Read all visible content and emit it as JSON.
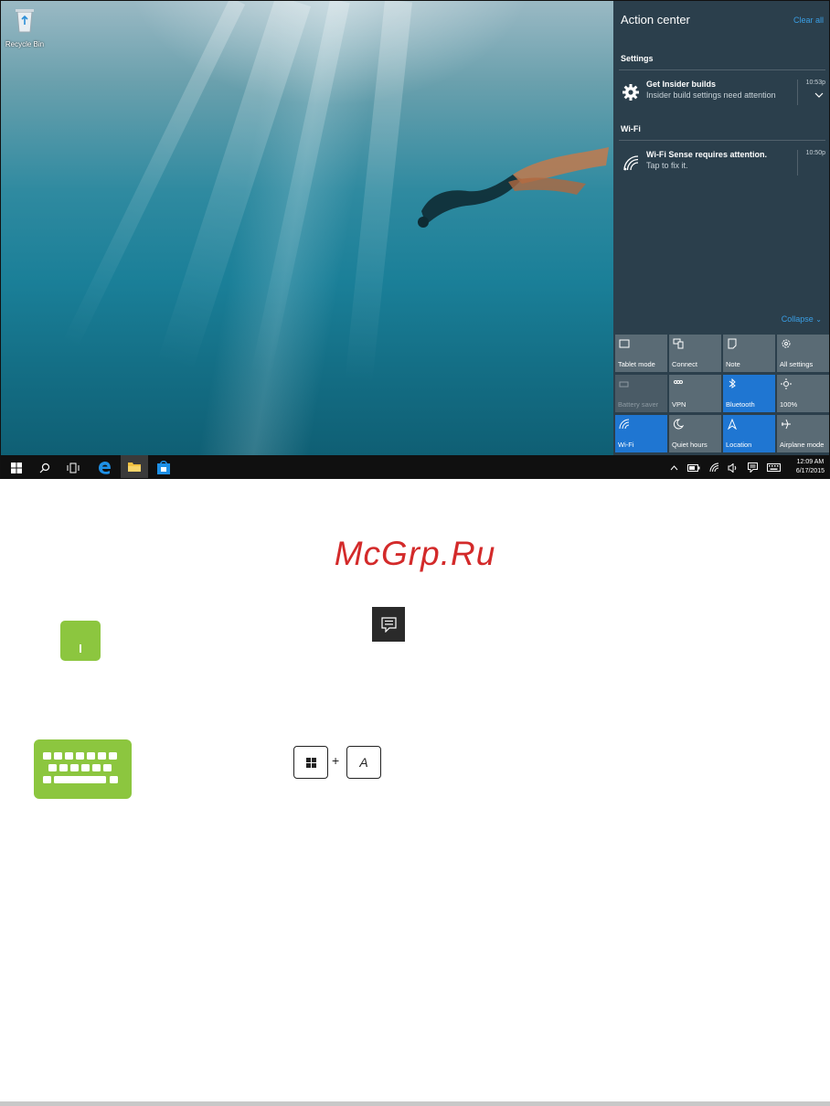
{
  "desktop": {
    "recycle_bin_label": "Recycle Bin"
  },
  "action_center": {
    "title": "Action center",
    "clear_all": "Clear all",
    "sections": [
      {
        "heading": "Settings",
        "notification": {
          "title": "Get Insider builds",
          "body": "Insider build settings need attention",
          "time": "10:53p",
          "icon": "gear-icon"
        }
      },
      {
        "heading": "Wi-Fi",
        "notification": {
          "title": "Wi-Fi Sense requires attention.",
          "body": "Tap to fix it.",
          "time": "10:50p",
          "icon": "wifi-icon"
        }
      }
    ],
    "collapse": "Collapse",
    "quick_actions": [
      {
        "label": "Tablet mode",
        "icon": "tablet-mode-icon",
        "state": "normal"
      },
      {
        "label": "Connect",
        "icon": "connect-icon",
        "state": "normal"
      },
      {
        "label": "Note",
        "icon": "note-icon",
        "state": "normal"
      },
      {
        "label": "All settings",
        "icon": "settings-icon",
        "state": "normal"
      },
      {
        "label": "Battery saver",
        "icon": "battery-icon",
        "state": "off"
      },
      {
        "label": "VPN",
        "icon": "vpn-icon",
        "state": "normal"
      },
      {
        "label": "Bluetooth",
        "icon": "bluetooth-icon",
        "state": "on"
      },
      {
        "label": "100%",
        "icon": "brightness-icon",
        "state": "normal"
      },
      {
        "label": "Wi-Fi",
        "icon": "wifi-icon",
        "state": "on"
      },
      {
        "label": "Quiet hours",
        "icon": "moon-icon",
        "state": "normal"
      },
      {
        "label": "Location",
        "icon": "location-icon",
        "state": "on"
      },
      {
        "label": "Airplane mode",
        "icon": "airplane-icon",
        "state": "normal"
      }
    ],
    "colors": {
      "panel": "#2b3f4c",
      "accent": "#1f76d2",
      "link": "#3a9ee4"
    }
  },
  "taskbar": {
    "clock_time": "12:09 AM",
    "clock_date": "6/17/2015",
    "apps": [
      "start-icon",
      "search-icon",
      "task-view-icon",
      "edge-icon",
      "file-explorer-icon",
      "store-icon"
    ]
  },
  "document": {
    "watermark": "McGrp.Ru",
    "shortcut_key": "A",
    "plus": "+",
    "colors": {
      "icon_green": "#8cc63f",
      "watermark": "#d32a2a"
    }
  }
}
